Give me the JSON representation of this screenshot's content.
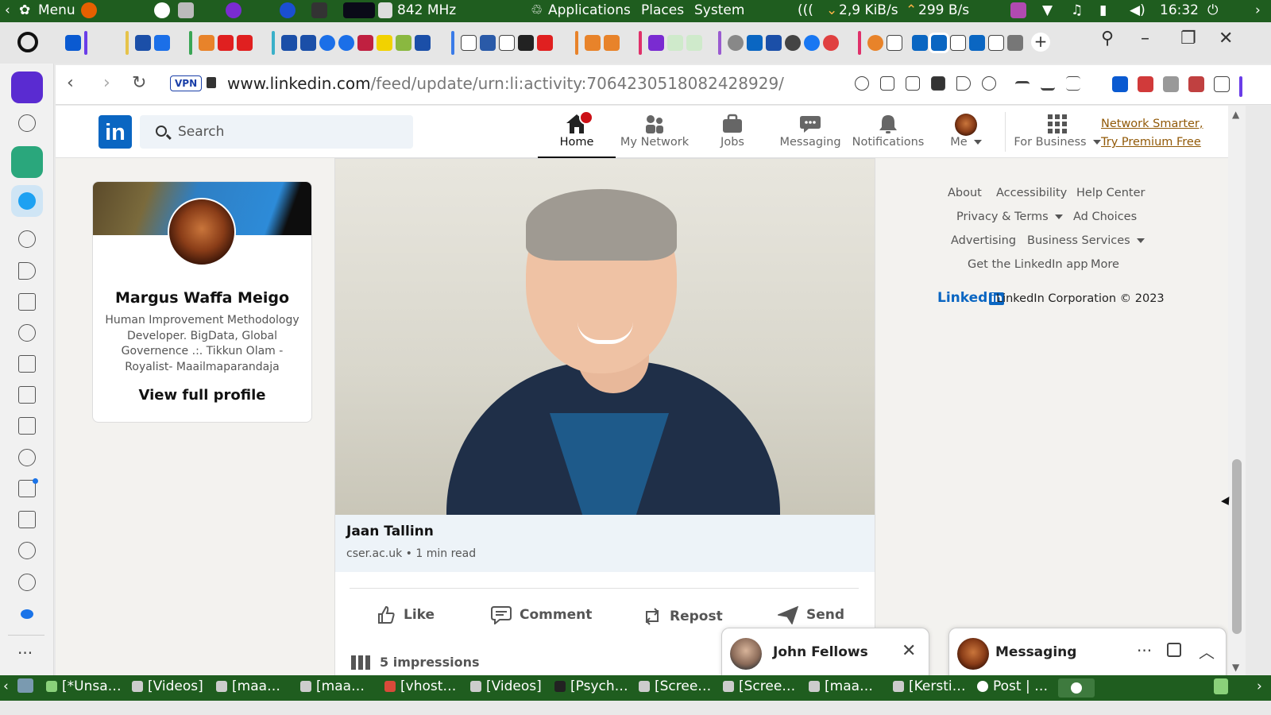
{
  "system_panel": {
    "menu_label": "Menu",
    "cpu_freq": "842 MHz",
    "menus": [
      "Applications",
      "Places",
      "System"
    ],
    "net_down": "2,9 KiB/s",
    "net_up": "299 B/s",
    "clock": "16:32"
  },
  "browser": {
    "url_host": "www.linkedin.com",
    "url_path": "/feed/update/urn:li:activity:7064230518082428929/",
    "vpn_label": "VPN"
  },
  "linkedin": {
    "search_placeholder": "Search",
    "nav": [
      {
        "label": "Home"
      },
      {
        "label": "My Network"
      },
      {
        "label": "Jobs"
      },
      {
        "label": "Messaging"
      },
      {
        "label": "Notifications"
      },
      {
        "label": "Me"
      },
      {
        "label": "For Business"
      }
    ],
    "premium_line1": "Network Smarter,",
    "premium_line2": "Try Premium Free",
    "profile": {
      "name": "Margus Waffa Meigo",
      "headline": "Human Improvement Methodology Developer. BigData, Global Governence .:. Tikkun Olam -Royalist- Maailmaparandaja",
      "view_full": "View full profile"
    },
    "post": {
      "article_title": "Jaan Tallinn",
      "article_source": "cser.ac.uk • 1 min read",
      "actions": [
        "Like",
        "Comment",
        "Repost",
        "Send"
      ],
      "impressions": "5 impressions"
    },
    "footer": {
      "about": "About",
      "accessibility": "Accessibility",
      "help": "Help Center",
      "privacy": "Privacy & Terms",
      "ad_choices": "Ad Choices",
      "advertising": "Advertising",
      "business_services": "Business Services",
      "get_app": "Get the LinkedIn app",
      "more": "More",
      "brand_word": "Linked",
      "brand_box": "in",
      "copyright": "LinkedIn Corporation © 2023"
    },
    "chats": {
      "conversation": "John Fellows",
      "messaging": "Messaging"
    }
  },
  "taskbar": [
    "[*Unsa…",
    "[Videos]",
    "[maa…",
    "[maa…",
    "[vhost…",
    "[Videos]",
    "[Psych…",
    "[Scree…",
    "[Scree…",
    "[maa…",
    "[Kersti…",
    "Post | …"
  ]
}
